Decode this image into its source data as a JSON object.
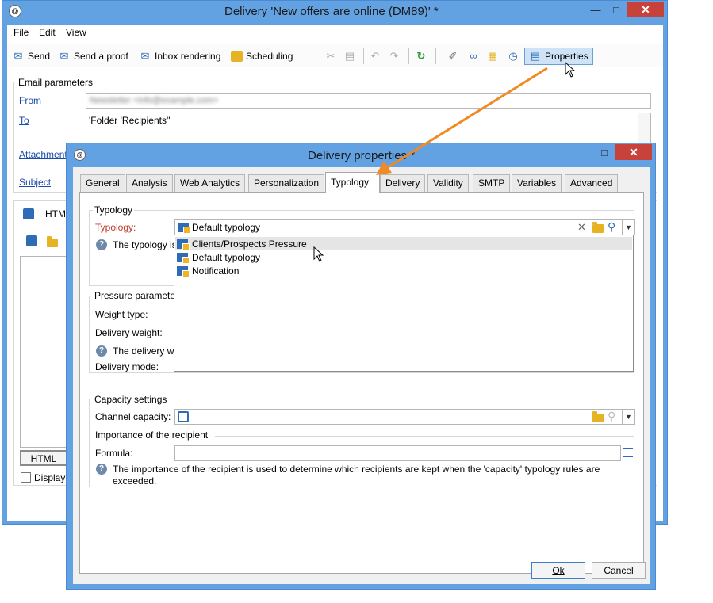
{
  "main_window": {
    "title": "Delivery 'New offers are online  (DM89)' *",
    "menu": [
      "File",
      "Edit",
      "View"
    ],
    "toolbar": {
      "send": "Send",
      "send_proof": "Send a proof",
      "inbox_rendering": "Inbox rendering",
      "scheduling": "Scheduling",
      "properties": "Properties"
    },
    "email_parameters": {
      "group_title": "Email parameters",
      "from_label": "From",
      "from_value": "Newsletter <info@example.com>",
      "to_label": "To",
      "to_value": "'Folder 'Recipients''",
      "attachment_label": "Attachment",
      "subject_label": "Subject"
    },
    "content": {
      "tab_html_partial": "HTM",
      "html_button": "HTML",
      "display_label": "Display"
    }
  },
  "dialog": {
    "title": "Delivery properties *",
    "tabs": [
      "General",
      "Analysis",
      "Web Analytics",
      "Personalization",
      "Typology",
      "Delivery",
      "Validity",
      "SMTP",
      "Variables",
      "Advanced"
    ],
    "active_tab": "Typology",
    "typology": {
      "group_title": "Typology",
      "label": "Typology:",
      "value": "Default typology",
      "help_text_partial": "The typology is",
      "dropdown_options": [
        "Clients/Prospects Pressure",
        "Default typology",
        "Notification"
      ],
      "highlighted_option": "Clients/Prospects Pressure"
    },
    "pressure": {
      "group_title_partial": "Pressure parameter",
      "weight_type_label": "Weight type:",
      "delivery_weight_label": "Delivery weight:",
      "help_text_partial": "The delivery we",
      "delivery_mode_label": "Delivery mode:"
    },
    "capacity": {
      "group_title": "Capacity settings",
      "channel_capacity_label": "Channel capacity:",
      "importance_title": "Importance of the recipient",
      "formula_label": "Formula:",
      "help_text_line1": "The importance of the recipient is used to determine which recipients are kept when the 'capacity' typology rules are",
      "help_text_line2": "exceeded."
    },
    "buttons": {
      "ok": "Ok",
      "cancel": "Cancel"
    }
  },
  "colors": {
    "window_frame": "#62a2e2",
    "close_button": "#c7423a",
    "required_label": "#c0392b",
    "arrow": "#f08a24"
  }
}
